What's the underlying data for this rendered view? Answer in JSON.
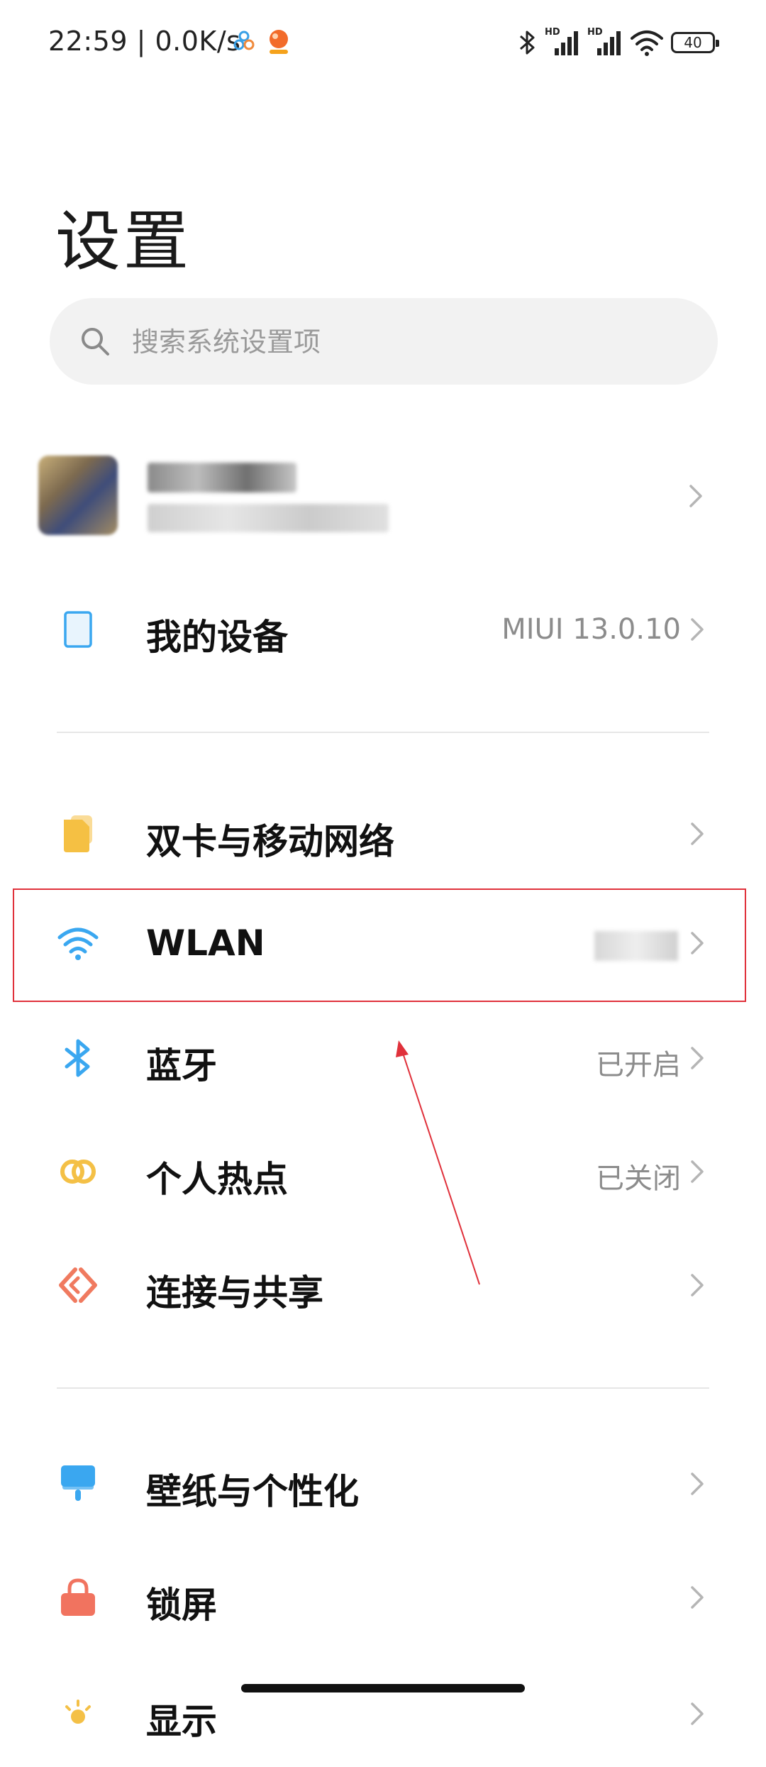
{
  "status_bar": {
    "time_speed": "22:59 | 0.0K/s",
    "signal_badge_1": "HD",
    "signal_badge_2": "HD",
    "battery_level": "40",
    "icons": [
      "app-notification-icon",
      "app-notification-icon-2",
      "bluetooth-icon",
      "signal-icon",
      "signal-icon",
      "wifi-icon",
      "battery-icon"
    ]
  },
  "page": {
    "title": "设置"
  },
  "search": {
    "placeholder": "搜索系统设置项"
  },
  "rows": [
    {
      "label": "我的设备",
      "value": "MIUI 13.0.10",
      "icon": "device-icon"
    },
    {
      "label": "双卡与移动网络",
      "value": "",
      "icon": "sim-card-icon"
    },
    {
      "label": "WLAN",
      "value": "",
      "icon": "wifi-icon"
    },
    {
      "label": "蓝牙",
      "value": "已开启",
      "icon": "bluetooth-icon"
    },
    {
      "label": "个人热点",
      "value": "已关闭",
      "icon": "hotspot-icon"
    },
    {
      "label": "连接与共享",
      "value": "",
      "icon": "connection-share-icon"
    },
    {
      "label": "壁纸与个性化",
      "value": "",
      "icon": "wallpaper-icon"
    },
    {
      "label": "锁屏",
      "value": "",
      "icon": "lock-icon"
    },
    {
      "label": "显示",
      "value": "",
      "icon": "display-icon"
    }
  ],
  "colors": {
    "accent_blue": "#3aa7f0",
    "sim_yellow": "#f5c043",
    "hotspot_yellow": "#f4c046",
    "share_orange": "#f07a5f",
    "lock_red": "#f1735f",
    "highlight_red": "#e0313b"
  }
}
